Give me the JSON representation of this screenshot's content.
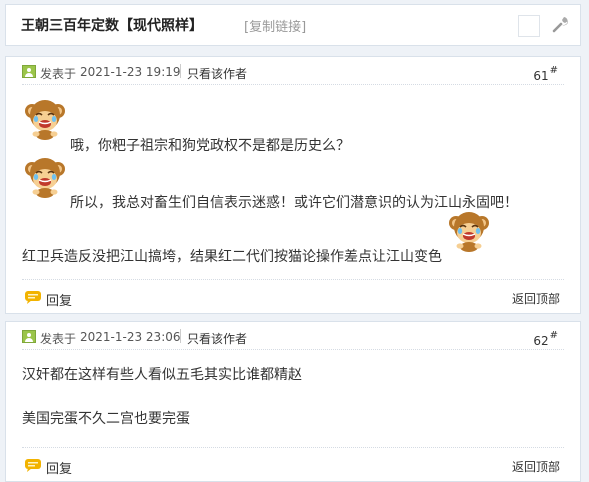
{
  "thread": {
    "title": "王朝三百年定数【现代照样】",
    "copy_link": "[复制链接]"
  },
  "labels": {
    "posted_at": "发表于",
    "only_author": "只看该作者",
    "reply": "回复",
    "back_to_top": "返回顶部"
  },
  "icons": {
    "user": "user-icon",
    "reply": "speech-bubble-icon",
    "header_tool": "wrench-icon",
    "emoticon": "laughing-monkey-emoticon"
  },
  "posts": [
    {
      "time": "2021-1-23 19:19",
      "floor": "61",
      "floor_mark": "#",
      "lines": [
        "哦，你粑子祖宗和狗党政权不是都是历史么？",
        "所以，我总对畜生们自信表示迷惑！或许它们潜意识的认为江山永固吧！",
        "红卫兵造反没把江山搞垮，结果红二代们按猫论操作差点让江山变色"
      ]
    },
    {
      "time": "2021-1-23 23:06",
      "floor": "62",
      "floor_mark": "#",
      "lines": [
        "汉奸都在这样有些人看似五毛其实比谁都精赵",
        "美国完蛋不久二宫也要完蛋"
      ]
    }
  ],
  "colors": {
    "background": "#eef2f7",
    "border": "#d9e1ea",
    "user_icon": "#9bc54a",
    "reply_icon": "#f2b300"
  }
}
